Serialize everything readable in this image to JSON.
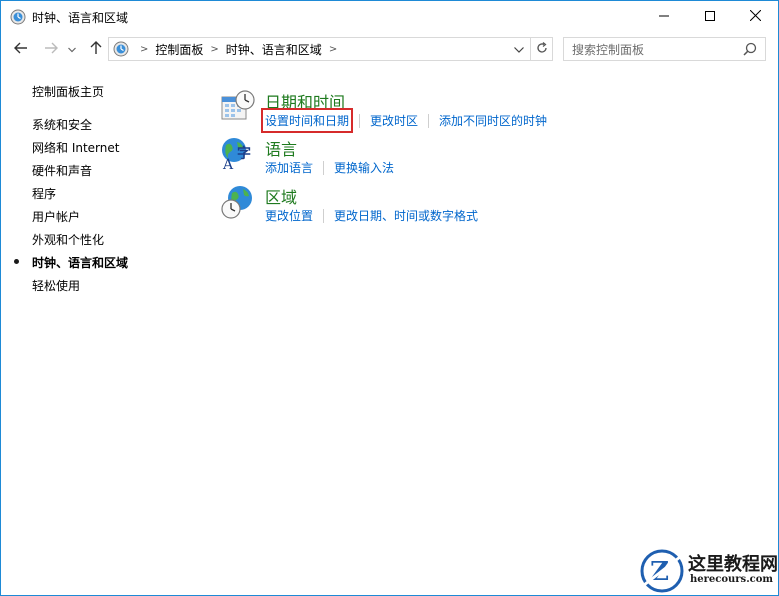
{
  "window": {
    "title": "时钟、语言和区域",
    "accent_color": "#1e8ad6"
  },
  "address_bar": {
    "breadcrumb": [
      "控制面板",
      "时钟、语言和区域"
    ],
    "search_placeholder": "搜索控制面板"
  },
  "left_nav": {
    "items": [
      {
        "label": "控制面板主页",
        "current": false
      },
      {
        "label": "系统和安全",
        "current": false
      },
      {
        "label": "网络和 Internet",
        "current": false
      },
      {
        "label": "硬件和声音",
        "current": false
      },
      {
        "label": "程序",
        "current": false
      },
      {
        "label": "用户帐户",
        "current": false
      },
      {
        "label": "外观和个性化",
        "current": false
      },
      {
        "label": "时钟、语言和区域",
        "current": true
      },
      {
        "label": "轻松使用",
        "current": false
      }
    ]
  },
  "categories": [
    {
      "icon": "calendar-clock-icon",
      "title": "日期和时间",
      "links": [
        "设置时间和日期",
        "更改时区",
        "添加不同时区的时钟"
      ],
      "highlighted_link": "设置时间和日期"
    },
    {
      "icon": "language-globe-icon",
      "title": "语言",
      "links": [
        "添加语言",
        "更换输入法"
      ]
    },
    {
      "icon": "region-globe-clock-icon",
      "title": "区域",
      "links": [
        "更改位置",
        "更改日期、时间或数字格式"
      ]
    }
  ],
  "colors": {
    "category_title": "#1e7a1e",
    "link": "#0066cc",
    "highlight_box": "#d62b2b"
  },
  "watermark": {
    "chinese": "这里教程网",
    "english": "herecours.com"
  }
}
